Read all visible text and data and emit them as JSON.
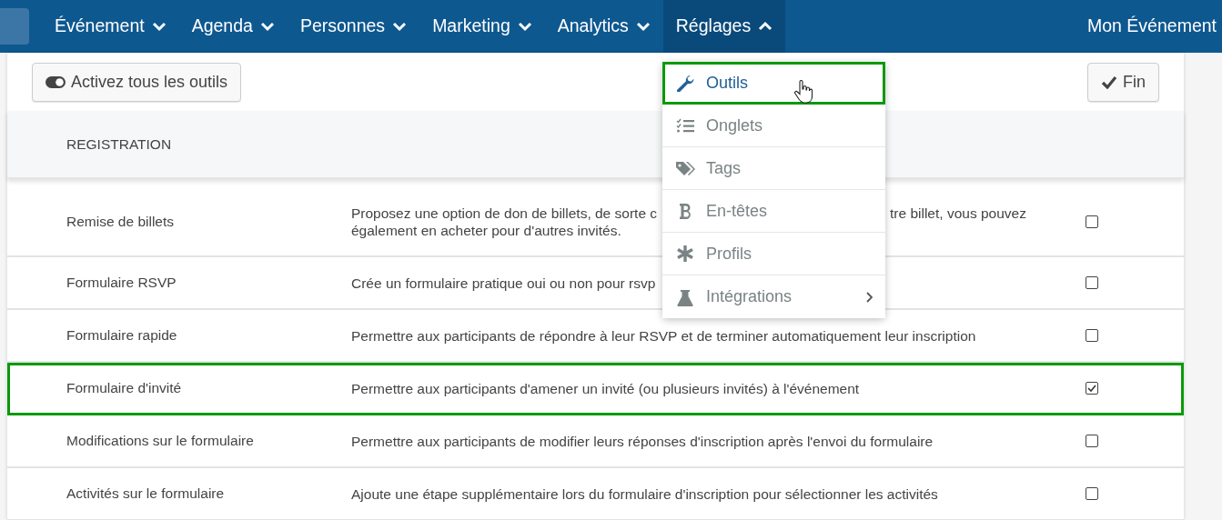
{
  "nav": {
    "items": [
      {
        "label": "Événement",
        "expanded": false
      },
      {
        "label": "Agenda",
        "expanded": false
      },
      {
        "label": "Personnes",
        "expanded": false
      },
      {
        "label": "Marketing",
        "expanded": false
      },
      {
        "label": "Analytics",
        "expanded": false
      },
      {
        "label": "Réglages",
        "expanded": true
      }
    ],
    "event": "Mon Événement"
  },
  "toolbar": {
    "toggle_all": "Activez tous les outils",
    "done": "Fin"
  },
  "section": "REGISTRATION",
  "rows": [
    {
      "name": "Remise de billets",
      "description": "Proposez une option de don de billets, de sorte c",
      "description_tail": "tre billet, vous pouvez",
      "description_line2": "également en acheter pour d'autres invités.",
      "checked": false,
      "highlighted": false
    },
    {
      "name": "Formulaire RSVP",
      "description": "Crée un formulaire pratique oui ou non pour rsvp",
      "checked": false,
      "highlighted": false
    },
    {
      "name": "Formulaire rapide",
      "description": "Permettre aux participants de répondre à leur RSVP et de terminer automatiquement leur inscription",
      "checked": false,
      "highlighted": false
    },
    {
      "name": "Formulaire d'invité",
      "description": "Permettre aux participants d'amener un invité (ou plusieurs invités) à l'événement",
      "checked": true,
      "highlighted": true
    },
    {
      "name": "Modifications sur le formulaire",
      "description": "Permettre aux participants de modifier leurs réponses d'inscription après l'envoi du formulaire",
      "checked": false,
      "highlighted": false
    },
    {
      "name": "Activités sur le formulaire",
      "description": "Ajoute une étape supplémentaire lors du formulaire d'inscription pour sélectionner les activités",
      "checked": false,
      "highlighted": false
    }
  ],
  "menu": [
    {
      "label": "Outils",
      "kind": "wrench",
      "selected": true,
      "highlighted": true,
      "submenu": false
    },
    {
      "label": "Onglets",
      "kind": "checklist",
      "selected": false,
      "highlighted": false,
      "submenu": false
    },
    {
      "label": "Tags",
      "kind": "tags",
      "selected": false,
      "highlighted": false,
      "submenu": false
    },
    {
      "label": "En-têtes",
      "kind": "bold",
      "selected": false,
      "highlighted": false,
      "submenu": false
    },
    {
      "label": "Profils",
      "kind": "asterisk",
      "selected": false,
      "highlighted": false,
      "submenu": false
    },
    {
      "label": "Intégrations",
      "kind": "flask",
      "selected": false,
      "highlighted": false,
      "submenu": true
    }
  ]
}
